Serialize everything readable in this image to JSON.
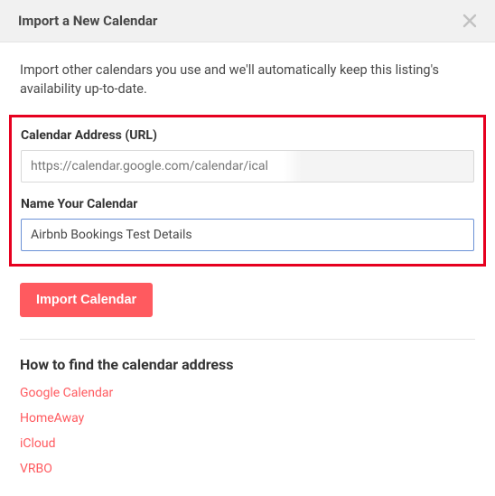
{
  "header": {
    "title": "Import a New Calendar"
  },
  "intro": "Import other calendars you use and we'll automatically keep this listing's availability up-to-date.",
  "form": {
    "url_label": "Calendar Address (URL)",
    "url_value": "https://calendar.google.com/calendar/ical",
    "name_label": "Name Your Calendar",
    "name_value": "Airbnb Bookings Test Details",
    "submit_label": "Import Calendar"
  },
  "help": {
    "heading": "How to find the calendar address",
    "links": [
      "Google Calendar",
      "HomeAway",
      "iCloud",
      "VRBO"
    ]
  }
}
